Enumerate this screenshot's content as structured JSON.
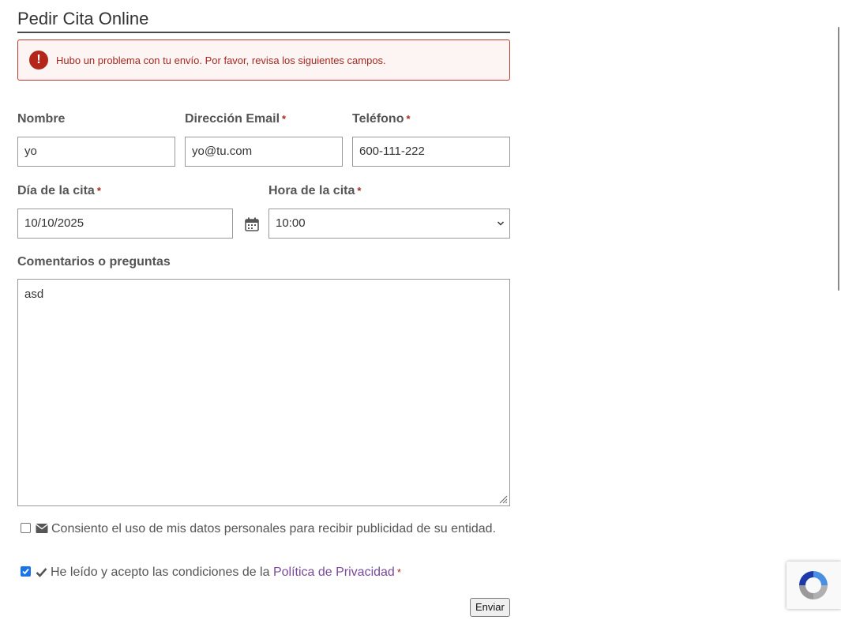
{
  "form": {
    "title": "Pedir Cita Online",
    "error_message": "Hubo un problema con tu envío. Por favor, revisa los siguientes campos.",
    "error_icon": "!",
    "required_mark": "*",
    "fields": {
      "name": {
        "label": "Nombre",
        "value": "yo"
      },
      "email": {
        "label": "Dirección Email",
        "value": "yo@tu.com"
      },
      "phone": {
        "label": "Teléfono",
        "value": "600-111-222"
      },
      "date": {
        "label": "Día de la cita",
        "value": "10/10/2025"
      },
      "time": {
        "label": "Hora de la cita",
        "value": "10:00"
      },
      "comments": {
        "label": "Comentarios o preguntas",
        "value": "asd"
      }
    },
    "consent_text": "Consiento el uso de mis datos personales para recibir publicidad de su entidad.",
    "consent_checked": false,
    "privacy_prefix": "He leído y acepto las condiciones de la ",
    "privacy_link": "Política de Privacidad",
    "privacy_checked": true,
    "submit_label": "Enviar"
  },
  "colors": {
    "error": "#a52a1f",
    "link": "#7b4a9b",
    "checkbox_checked": "#1a73e8"
  },
  "icons": {
    "error": "exclamation-circle-icon",
    "calendar": "calendar-icon",
    "envelope": "envelope-icon",
    "check": "check-icon",
    "recaptcha": "recaptcha-logo-icon"
  }
}
